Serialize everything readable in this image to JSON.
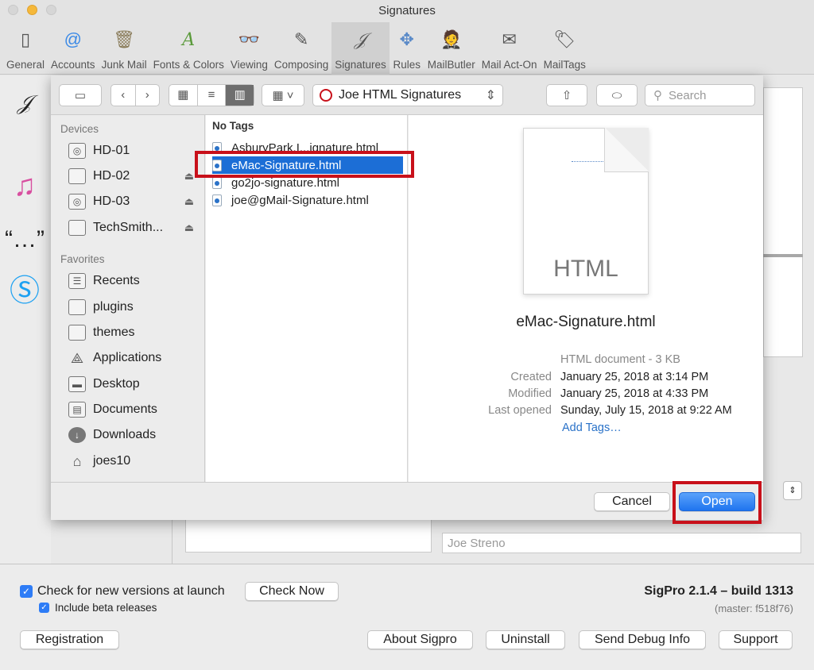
{
  "window": {
    "title": "Signatures"
  },
  "toolbar": {
    "items": [
      {
        "label": "General",
        "icon": "general-icon"
      },
      {
        "label": "Accounts",
        "icon": "at-icon"
      },
      {
        "label": "Junk Mail",
        "icon": "trash-icon"
      },
      {
        "label": "Fonts & Colors",
        "icon": "palette-icon"
      },
      {
        "label": "Viewing",
        "icon": "glasses-icon"
      },
      {
        "label": "Composing",
        "icon": "pencil-icon"
      },
      {
        "label": "Signatures",
        "icon": "signature-icon"
      },
      {
        "label": "Rules",
        "icon": "rules-icon"
      },
      {
        "label": "MailButler",
        "icon": "butler-icon"
      },
      {
        "label": "Mail Act-On",
        "icon": "act-on-icon"
      },
      {
        "label": "MailTags",
        "icon": "tags-icon"
      }
    ],
    "active": "Signatures"
  },
  "dialog": {
    "location": "Joe HTML Signatures",
    "search_placeholder": "Search",
    "sidebar": {
      "devices_heading": "Devices",
      "devices": [
        {
          "label": "HD-01",
          "eject": false
        },
        {
          "label": "HD-02",
          "eject": true
        },
        {
          "label": "HD-03",
          "eject": true
        },
        {
          "label": "TechSmith...",
          "eject": true
        }
      ],
      "favorites_heading": "Favorites",
      "favorites": [
        {
          "label": "Recents",
          "icon": "recents-icon"
        },
        {
          "label": "plugins",
          "icon": "folder-icon"
        },
        {
          "label": "themes",
          "icon": "folder-icon"
        },
        {
          "label": "Applications",
          "icon": "applications-icon"
        },
        {
          "label": "Desktop",
          "icon": "desktop-icon"
        },
        {
          "label": "Documents",
          "icon": "documents-icon"
        },
        {
          "label": "Downloads",
          "icon": "downloads-icon"
        },
        {
          "label": "joes10",
          "icon": "home-icon"
        }
      ]
    },
    "column": {
      "heading": "No Tags",
      "files": [
        "AsburyPark.I...ignature.html",
        "eMac-Signature.html",
        "go2jo-signature.html",
        "joe@gMail-Signature.html"
      ],
      "selected_index": 1
    },
    "preview": {
      "doc_label": "HTML",
      "filename": "eMac-Signature.html",
      "kind": "HTML document - 3 KB",
      "created_label": "Created",
      "created": "January 25, 2018 at 3:14 PM",
      "modified_label": "Modified",
      "modified": "January 25, 2018 at 4:33 PM",
      "opened_label": "Last opened",
      "opened": "Sunday, July 15, 2018 at 9:22 AM",
      "add_tags": "Add Tags…"
    },
    "cancel": "Cancel",
    "open": "Open"
  },
  "background": {
    "name_field": "Joe Streno"
  },
  "bottom": {
    "check_new_versions": "Check for new versions at launch",
    "include_beta": "Include beta releases",
    "check_now": "Check Now",
    "version": "SigPro 2.1.4 – build 1313",
    "master": "(master: f518f76)",
    "registration": "Registration",
    "about": "About Sigpro",
    "uninstall": "Uninstall",
    "debug": "Send Debug Info",
    "support": "Support"
  },
  "colors": {
    "accent": "#1c6ed6",
    "highlight": "#c8101a"
  }
}
